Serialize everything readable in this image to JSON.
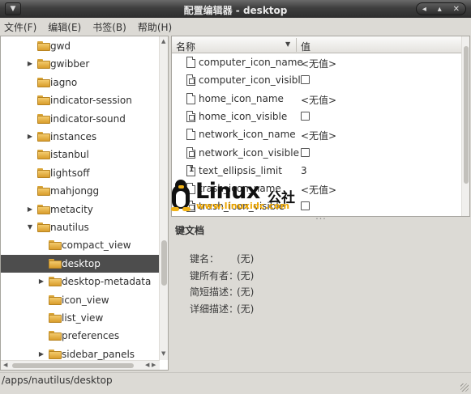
{
  "window": {
    "title": "配置编辑器 - desktop"
  },
  "menubar": [
    "文件(F)",
    "编辑(E)",
    "书签(B)",
    "帮助(H)"
  ],
  "tree": [
    {
      "label": "gwd",
      "level": 1,
      "expander": ""
    },
    {
      "label": "gwibber",
      "level": 1,
      "expander": "▶"
    },
    {
      "label": "iagno",
      "level": 1,
      "expander": ""
    },
    {
      "label": "indicator-session",
      "level": 1,
      "expander": ""
    },
    {
      "label": "indicator-sound",
      "level": 1,
      "expander": ""
    },
    {
      "label": "instances",
      "level": 1,
      "expander": "▶"
    },
    {
      "label": "istanbul",
      "level": 1,
      "expander": ""
    },
    {
      "label": "lightsoff",
      "level": 1,
      "expander": ""
    },
    {
      "label": "mahjongg",
      "level": 1,
      "expander": ""
    },
    {
      "label": "metacity",
      "level": 1,
      "expander": "▶"
    },
    {
      "label": "nautilus",
      "level": 1,
      "expander": "▼"
    },
    {
      "label": "compact_view",
      "level": 2,
      "expander": ""
    },
    {
      "label": "desktop",
      "level": 2,
      "expander": "",
      "selected": true
    },
    {
      "label": "desktop-metadata",
      "level": 2,
      "expander": "▶"
    },
    {
      "label": "icon_view",
      "level": 2,
      "expander": ""
    },
    {
      "label": "list_view",
      "level": 2,
      "expander": ""
    },
    {
      "label": "preferences",
      "level": 2,
      "expander": ""
    },
    {
      "label": "sidebar_panels",
      "level": 2,
      "expander": "▶"
    }
  ],
  "keys": {
    "name_header": "名称",
    "value_header": "值",
    "rows": [
      {
        "name": "computer_icon_name",
        "type": "string",
        "value": "<无值>"
      },
      {
        "name": "computer_icon_visible",
        "type": "bool",
        "value": ""
      },
      {
        "name": "home_icon_name",
        "type": "string",
        "value": "<无值>"
      },
      {
        "name": "home_icon_visible",
        "type": "bool",
        "value": ""
      },
      {
        "name": "network_icon_name",
        "type": "string",
        "value": "<无值>"
      },
      {
        "name": "network_icon_visible",
        "type": "bool",
        "value": ""
      },
      {
        "name": "text_ellipsis_limit",
        "type": "int",
        "value": "3"
      },
      {
        "name": "trash_icon_name",
        "type": "string",
        "value": "<无值>"
      },
      {
        "name": "trash_icon_visible",
        "type": "bool",
        "value": ""
      }
    ]
  },
  "details": {
    "title": "键文档",
    "rows": [
      {
        "label": "键名：",
        "value": "(无)"
      },
      {
        "label": "键所有者：",
        "value": "(无)"
      },
      {
        "label": "简短描述：",
        "value": "(无)"
      },
      {
        "label": "详细描述：",
        "value": "(无)"
      }
    ]
  },
  "watermark": {
    "brand": "Linux",
    "cn": "公社",
    "url": "www.linuxidc.com",
    "accent": "#f0a800"
  },
  "statusbar": {
    "path": "/apps/nautilus/desktop"
  },
  "colors": {
    "selected_row": "#4d4d4d",
    "folder": "#e8b649"
  }
}
